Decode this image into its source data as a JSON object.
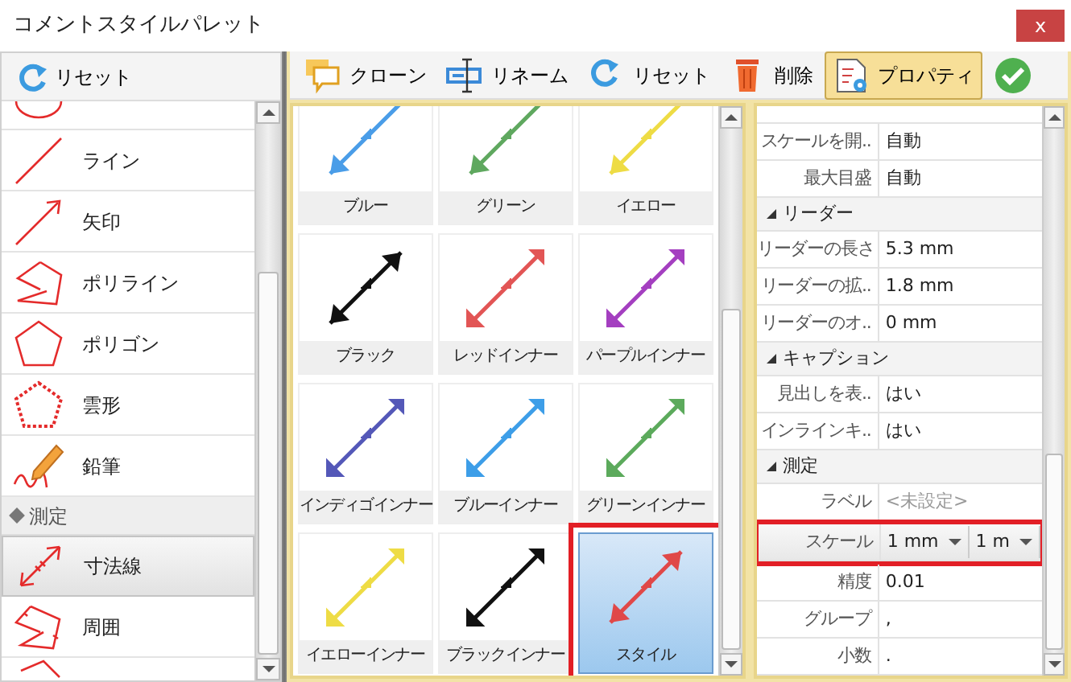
{
  "window": {
    "title": "コメントスタイルパレット",
    "close": "x"
  },
  "left_panel": {
    "reset_button": {
      "label": "リセット"
    },
    "items": [
      {
        "kind": "item",
        "label": "ライン",
        "selected": false
      },
      {
        "kind": "item",
        "label": "矢印",
        "selected": false
      },
      {
        "kind": "item",
        "label": "ポリライン",
        "selected": false
      },
      {
        "kind": "item",
        "label": "ポリゴン",
        "selected": false
      },
      {
        "kind": "item",
        "label": "雲形",
        "selected": false
      },
      {
        "kind": "item",
        "label": "鉛筆",
        "selected": false
      },
      {
        "kind": "group",
        "label": "測定"
      },
      {
        "kind": "item",
        "label": "寸法線",
        "selected": true
      },
      {
        "kind": "item",
        "label": "周囲",
        "selected": false
      }
    ]
  },
  "toolbar": [
    {
      "label": "クローン",
      "active": false
    },
    {
      "label": "リネーム",
      "active": false
    },
    {
      "label": "リセット",
      "active": false
    },
    {
      "label": "削除",
      "active": false
    },
    {
      "label": "プロパティ",
      "active": true
    },
    {
      "active": false
    }
  ],
  "gallery": [
    {
      "label": "ブルー",
      "kind": "single",
      "color": "#4a9de8",
      "selected": false
    },
    {
      "label": "グリーン",
      "kind": "single",
      "color": "#5fa85f",
      "selected": false
    },
    {
      "label": "イエロー",
      "kind": "single",
      "color": "#eedc45",
      "selected": false
    },
    {
      "label": "ブラック",
      "kind": "double",
      "color": "#111111",
      "selected": false
    },
    {
      "label": "レッドインナー",
      "kind": "inner",
      "color": "#e25555",
      "selected": false
    },
    {
      "label": "パープルインナー",
      "kind": "inner",
      "color": "#a43fc0",
      "selected": false
    },
    {
      "label": "インディゴインナー",
      "kind": "inner",
      "color": "#5458b8",
      "selected": false
    },
    {
      "label": "ブルーインナー",
      "kind": "inner",
      "color": "#3d9ee8",
      "selected": false
    },
    {
      "label": "グリーンインナー",
      "kind": "inner",
      "color": "#5caa5c",
      "selected": false
    },
    {
      "label": "イエローインナー",
      "kind": "inner",
      "color": "#eedc45",
      "selected": false
    },
    {
      "label": "ブラックインナー",
      "kind": "inner",
      "color": "#111111",
      "selected": false
    },
    {
      "label": "スタイル",
      "kind": "double",
      "color": "#e04848",
      "selected": true
    }
  ],
  "properties": [
    {
      "kind": "row",
      "name": "スケールを開..",
      "value": "自動",
      "disabled": false
    },
    {
      "kind": "row",
      "name": "最大目盛",
      "value": "自動",
      "disabled": false
    },
    {
      "kind": "header",
      "name": "リーダー",
      "expanded": true
    },
    {
      "kind": "row",
      "name": "リーダーの長さ",
      "value": "5.3 mm",
      "disabled": false
    },
    {
      "kind": "row",
      "name": "リーダーの拡..",
      "value": "1.8 mm",
      "disabled": false
    },
    {
      "kind": "row",
      "name": "リーダーのオ..",
      "value": "0 mm",
      "disabled": false
    },
    {
      "kind": "header",
      "name": "キャプション",
      "expanded": true
    },
    {
      "kind": "row",
      "name": "見出しを表..",
      "value": "はい",
      "disabled": false
    },
    {
      "kind": "row",
      "name": "インラインキ..",
      "value": "はい",
      "disabled": false
    },
    {
      "kind": "header",
      "name": "測定",
      "expanded": true
    },
    {
      "kind": "row",
      "name": "ラベル",
      "value": "<未設定>",
      "disabled": true
    },
    {
      "kind": "dropdowns",
      "name": "スケール",
      "values": [
        "1 mm",
        "1 m"
      ],
      "selected": true
    },
    {
      "kind": "row",
      "name": "精度",
      "value": "0.01",
      "disabled": false
    },
    {
      "kind": "row",
      "name": "グループ",
      "value": ",",
      "disabled": false
    },
    {
      "kind": "row",
      "name": "小数",
      "value": ".",
      "disabled": false
    }
  ]
}
